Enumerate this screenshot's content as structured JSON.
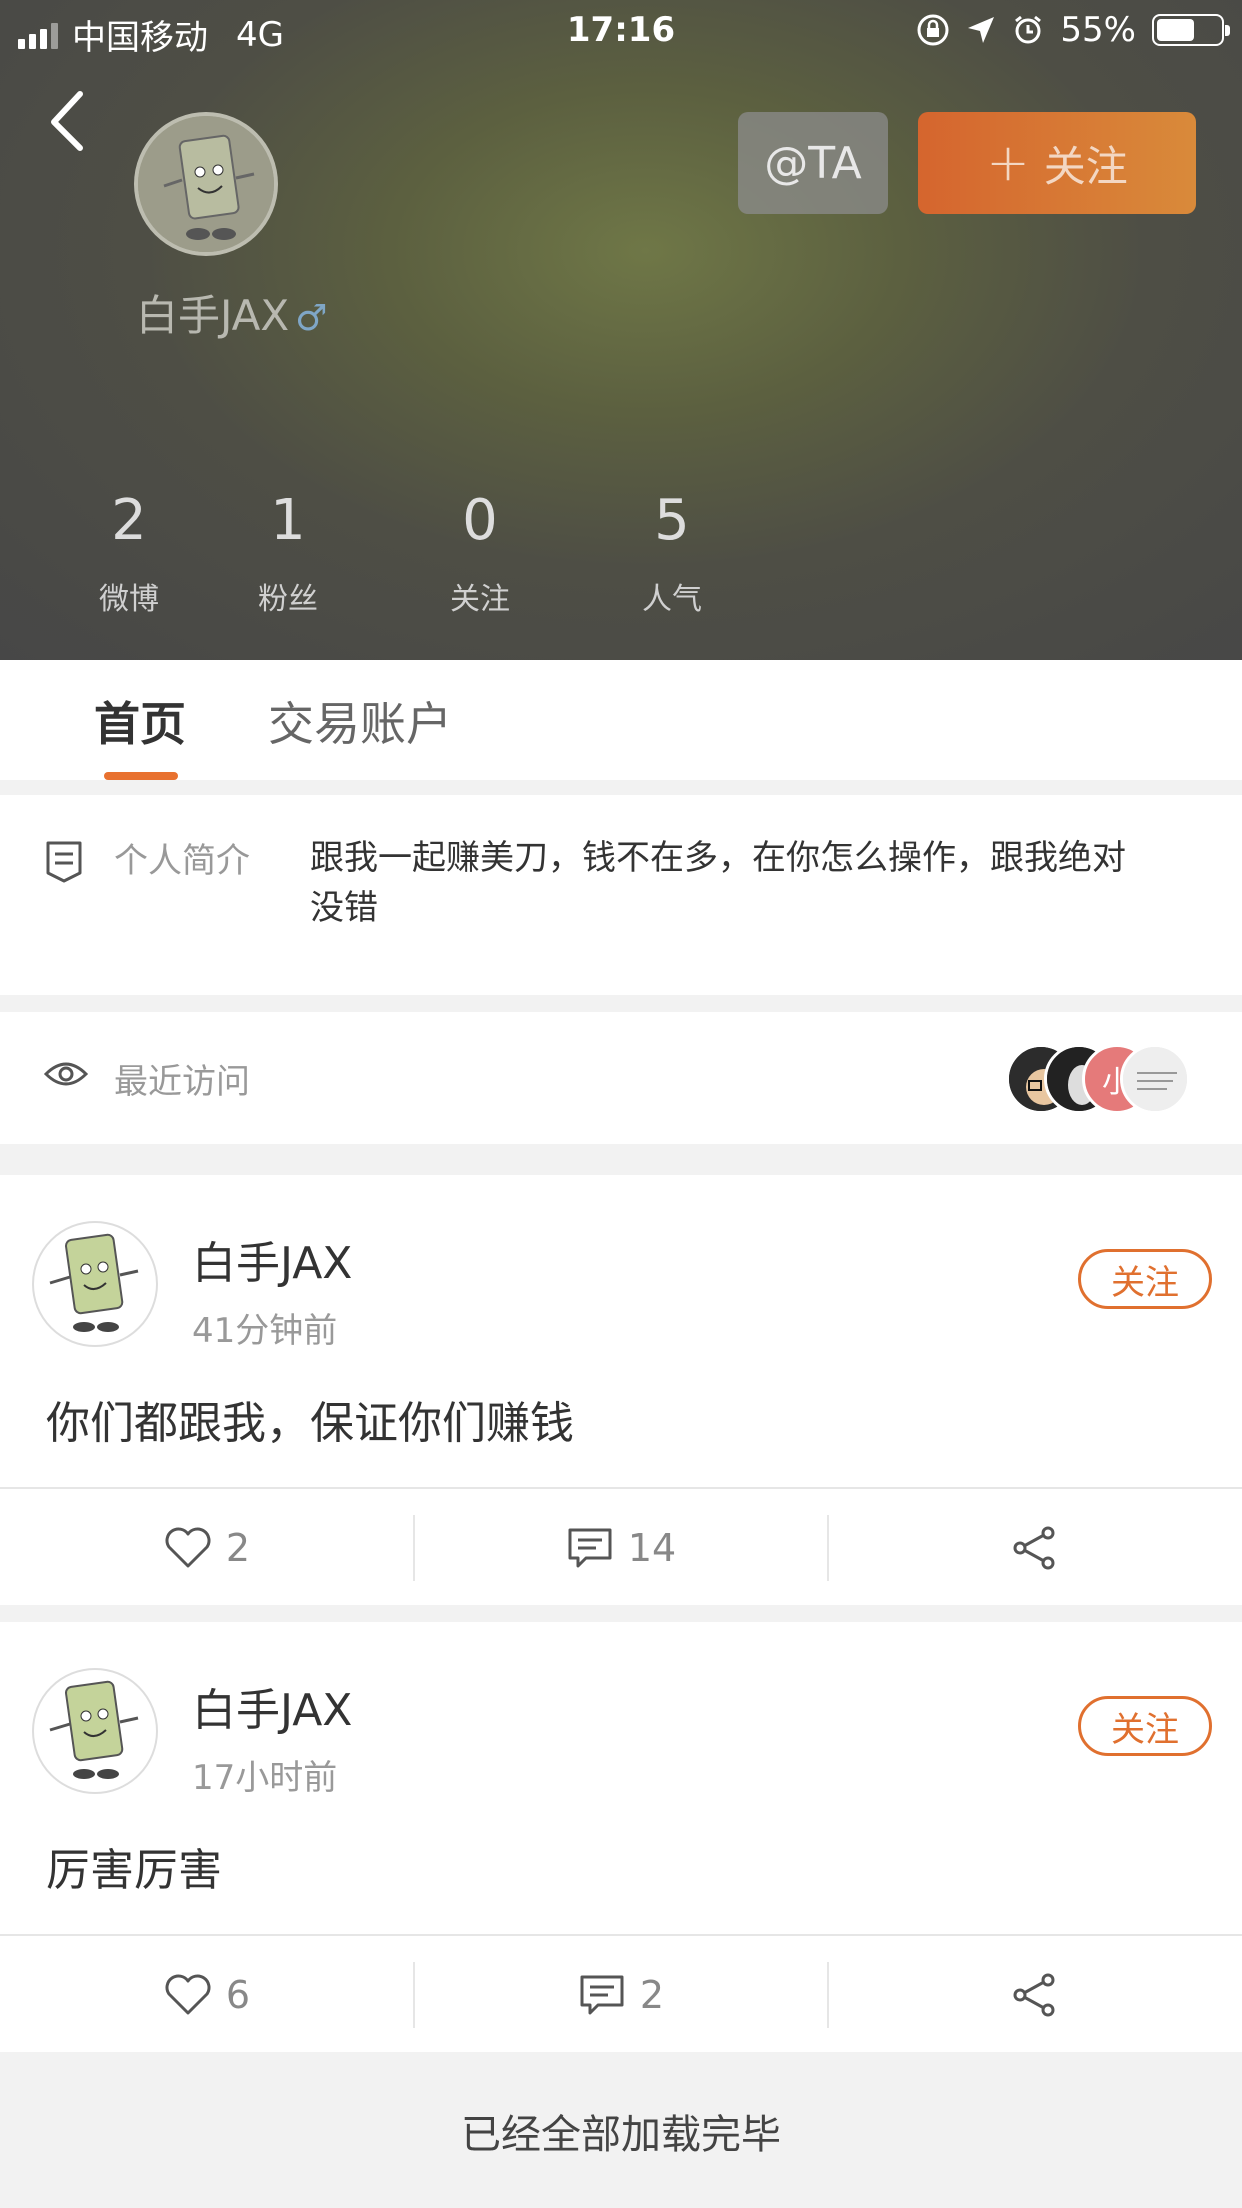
{
  "status_bar": {
    "carrier": "中国移动",
    "network": "4G",
    "time": "17:16",
    "battery": "55%",
    "battery_level": 0.55
  },
  "profile": {
    "name": "白手JAX",
    "gender_symbol": "♂",
    "at_label": "@TA",
    "follow_label": "关注",
    "follow_plus": "+"
  },
  "stats": [
    {
      "value": "2",
      "label": "微博"
    },
    {
      "value": "1",
      "label": "粉丝"
    },
    {
      "value": "0",
      "label": "关注"
    },
    {
      "value": "5",
      "label": "人气"
    }
  ],
  "tabs": [
    {
      "label": "首页",
      "active": true
    },
    {
      "label": "交易账户",
      "active": false
    }
  ],
  "bio": {
    "label": "个人简介",
    "text": "跟我一起赚美刀，钱不在多，在你怎么操作，跟我绝对没错"
  },
  "recent_visits": {
    "label": "最近访问",
    "visitor_char": "小"
  },
  "posts": [
    {
      "author": "白手JAX",
      "time": "41分钟前",
      "follow": "关注",
      "text": "你们都跟我，保证你们赚钱",
      "likes": "2",
      "comments": "14"
    },
    {
      "author": "白手JAX",
      "time": "17小时前",
      "follow": "关注",
      "text": "厉害厉害",
      "likes": "6",
      "comments": "2"
    }
  ],
  "footer": {
    "text": "已经全部加载完毕"
  },
  "colors": {
    "accent": "#e0702f",
    "hero_bg": "#4e4e45"
  }
}
